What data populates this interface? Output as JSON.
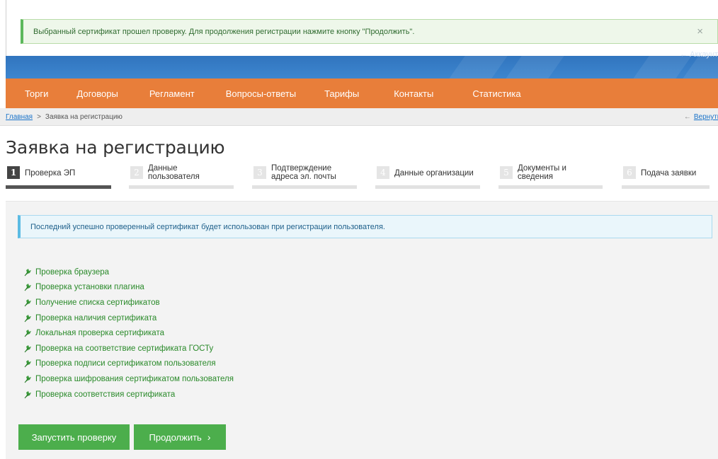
{
  "alert_success": {
    "text": "Выбранный сертификат прошел проверку. Для продолжения регистрации нажмите кнопку \"Продолжить\".",
    "close": "×"
  },
  "banner": {
    "small_text": "← Аккаунт"
  },
  "nav": {
    "items": [
      "Торги",
      "Договоры",
      "Регламент",
      "Вопросы-ответы",
      "Тарифы",
      "Контакты",
      "Статистика"
    ]
  },
  "breadcrumb": {
    "home": "Главная",
    "separator": ">",
    "current": "Заявка на регистрацию",
    "back": "Вернуть"
  },
  "page_title": "Заявка на регистрацию",
  "steps": [
    {
      "num": "1",
      "line1": "Проверка ЭП",
      "line2": "",
      "active": true
    },
    {
      "num": "2",
      "line1": "Данные",
      "line2": "пользователя",
      "active": false
    },
    {
      "num": "3",
      "line1": "Подтверждение",
      "line2": "адреса эл. почты",
      "active": false
    },
    {
      "num": "4",
      "line1": "Данные организации",
      "line2": "",
      "active": false
    },
    {
      "num": "5",
      "line1": "Документы и",
      "line2": "сведения",
      "active": false
    },
    {
      "num": "6",
      "line1": "Подача заявки",
      "line2": "",
      "active": false
    }
  ],
  "alert_info": {
    "text": "Последний успешно проверенный сертификат будет использован при регистрации пользователя."
  },
  "checks": [
    "Проверка браузера",
    "Проверка установки плагина",
    "Получение списка сертификатов",
    "Проверка наличия сертификата",
    "Локальная проверка сертификата",
    "Проверка на соответствие сертификата ГОСТу",
    "Проверка подписи сертификатом пользователя",
    "Проверка шифрования сертификатом пользователя",
    "Проверка соответствия сертификата"
  ],
  "buttons": {
    "start": "Запустить проверку",
    "continue": "Продолжить",
    "continue_icon": "chevron-right-icon"
  },
  "colors": {
    "nav_bg": "#e87e3a",
    "success_green": "#4cae4c",
    "check_green": "#2a8a2a",
    "link_blue": "#1a73c9"
  }
}
